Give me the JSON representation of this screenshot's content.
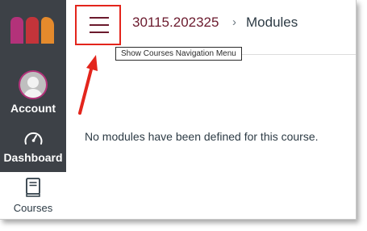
{
  "sidebar": {
    "logo_colors": [
      "#b3327a",
      "#c4343a",
      "#e58a2c"
    ],
    "items": [
      {
        "label": "Account",
        "icon": "user-avatar-icon"
      },
      {
        "label": "Dashboard",
        "icon": "speedometer-icon"
      },
      {
        "label": "Courses",
        "icon": "book-icon",
        "selected": true
      }
    ]
  },
  "header": {
    "menu_button_icon": "hamburger-menu-icon",
    "tooltip": "Show Courses Navigation Menu",
    "breadcrumb": {
      "course": "30115.202325",
      "separator": "›",
      "page": "Modules"
    }
  },
  "main": {
    "message": "No modules have been defined for this course."
  },
  "annotations": {
    "highlight_color": "#e3251c",
    "arrow_icon": "red-arrow-icon"
  }
}
